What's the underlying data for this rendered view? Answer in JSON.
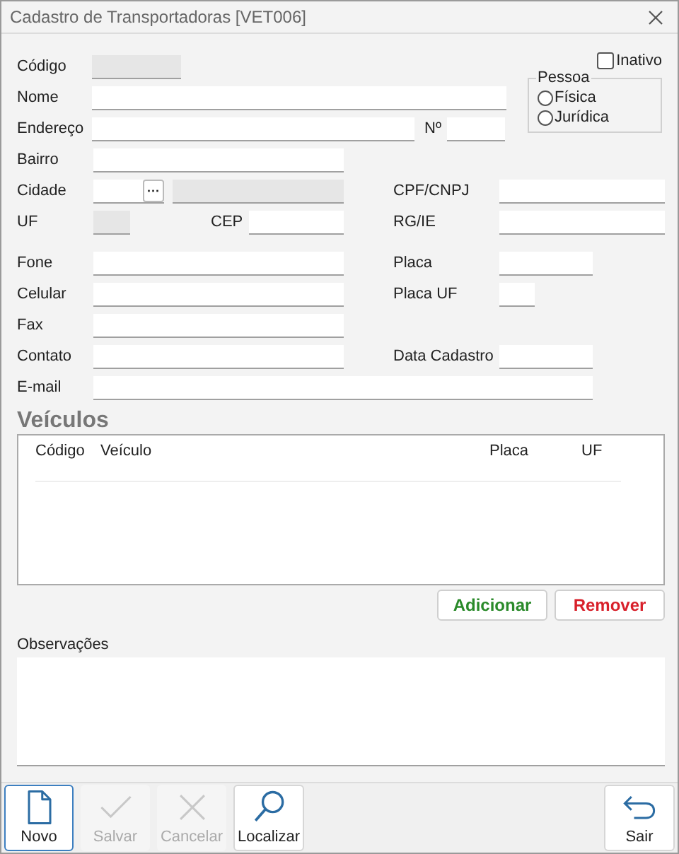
{
  "window": {
    "title": "Cadastro de Transportadoras [VET006]"
  },
  "inactive": {
    "label": "Inativo",
    "checked": false
  },
  "fields": {
    "codigo": {
      "label": "Código",
      "disabled": true
    },
    "nome": {
      "label": "Nome",
      "disabled": false
    },
    "endereco": {
      "label": "Endereço",
      "disabled": false
    },
    "numero": {
      "label": "Nº",
      "disabled": false
    },
    "bairro": {
      "label": "Bairro",
      "disabled": false
    },
    "cidade": {
      "label": "Cidade",
      "disabled": false,
      "lookup": "···"
    },
    "cidade_nome": {
      "disabled": true
    },
    "cpf_cnpj": {
      "label": "CPF/CNPJ",
      "disabled": false
    },
    "uf": {
      "label": "UF",
      "disabled": true
    },
    "cep": {
      "label": "CEP",
      "disabled": false
    },
    "rg_ie": {
      "label": "RG/IE",
      "disabled": false
    },
    "fone": {
      "label": "Fone",
      "disabled": false
    },
    "placa": {
      "label": "Placa",
      "disabled": false
    },
    "celular": {
      "label": "Celular",
      "disabled": false
    },
    "placa_uf": {
      "label": "Placa UF",
      "disabled": false
    },
    "fax": {
      "label": "Fax",
      "disabled": false
    },
    "contato": {
      "label": "Contato",
      "disabled": false
    },
    "data_cadastro": {
      "label": "Data Cadastro",
      "disabled": false
    },
    "email": {
      "label": "E-mail",
      "disabled": false
    }
  },
  "pessoa": {
    "title": "Pessoa",
    "options": [
      {
        "label": "Física",
        "selected": false
      },
      {
        "label": "Jurídica",
        "selected": false
      }
    ]
  },
  "vehicles": {
    "title": "Veículos",
    "columns": [
      "Código",
      "Veículo",
      "Placa",
      "UF"
    ]
  },
  "buttons": [
    {
      "label": "Adicionar",
      "kind": "add"
    },
    {
      "label": "Remover",
      "kind": "remove"
    }
  ],
  "notes": {
    "label": "Observações"
  },
  "toolbar": [
    {
      "label": "Novo",
      "kind": "new",
      "disabled": false,
      "selected": true
    },
    {
      "label": "Salvar",
      "kind": "save",
      "disabled": true,
      "selected": false
    },
    {
      "label": "Cancelar",
      "kind": "cancel",
      "disabled": true,
      "selected": false
    },
    {
      "label": "Localizar",
      "kind": "find",
      "disabled": false,
      "selected": false
    },
    {
      "label": "Sair",
      "kind": "exit",
      "disabled": false,
      "selected": false
    }
  ]
}
